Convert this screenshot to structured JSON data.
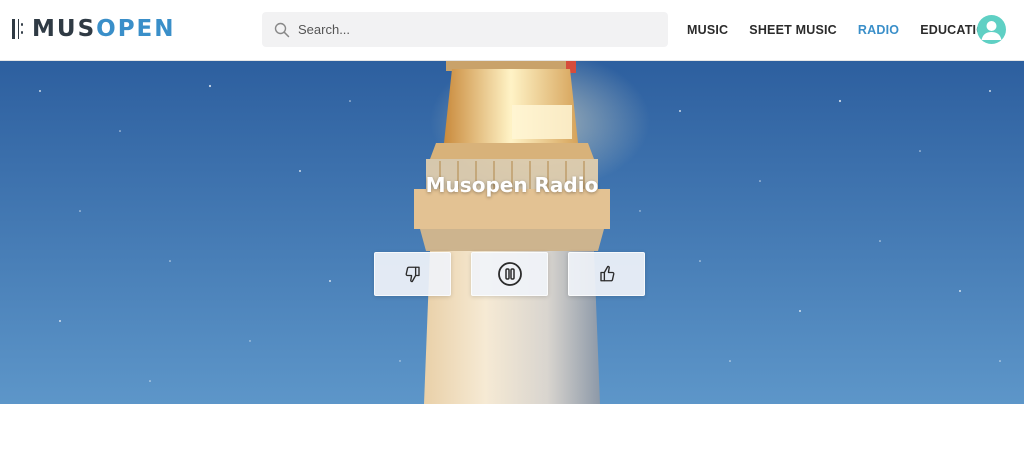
{
  "header": {
    "logo": {
      "part1": "MUS",
      "part2": "OPEN"
    },
    "search": {
      "placeholder": "Search..."
    },
    "nav": [
      {
        "label": "MUSIC"
      },
      {
        "label": "SHEET MUSIC"
      },
      {
        "label": "RADIO",
        "active": true
      },
      {
        "label": "EDUCATION"
      }
    ],
    "avatar_icon": "user-avatar-icon"
  },
  "hero": {
    "title": "Musopen Radio",
    "background": "lighthouse-night-sky",
    "controls": [
      {
        "name": "dislike",
        "icon": "thumbs-down-icon"
      },
      {
        "name": "pause",
        "icon": "pause-circle-icon"
      },
      {
        "name": "like",
        "icon": "thumbs-up-icon"
      }
    ]
  },
  "colors": {
    "accent": "#3a8fc9",
    "logo_dark": "#2f3a44",
    "avatar": "#5fd0c4",
    "sky": "#3d78b8"
  }
}
